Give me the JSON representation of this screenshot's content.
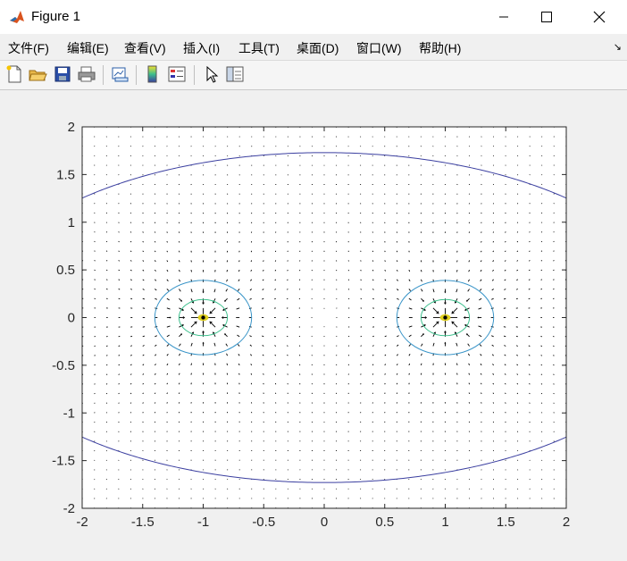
{
  "window": {
    "title": "Figure 1"
  },
  "menu": [
    {
      "label": "文件(F)"
    },
    {
      "label": "编辑(E)"
    },
    {
      "label": "查看(V)"
    },
    {
      "label": "插入(I)"
    },
    {
      "label": "工具(T)"
    },
    {
      "label": "桌面(D)"
    },
    {
      "label": "窗口(W)"
    },
    {
      "label": "帮助(H)"
    }
  ],
  "toolbar": {
    "icons": [
      "new-figure-icon",
      "open-file-icon",
      "save-icon",
      "print-icon",
      "link-plot-icon",
      "colorbar-icon",
      "legend-icon",
      "edit-plot-arrow-icon",
      "property-inspector-icon"
    ]
  },
  "colors": {
    "axes_bg": "#ffffff",
    "figure_bg": "#f0f0f0",
    "quiver": "#000000",
    "contour_outer": "#3b3fa0",
    "contour_mid": "#3a95c8",
    "contour_inner": "#3cbf8c",
    "contour_center": "#e0d020"
  },
  "chart_data": {
    "type": "contour+quiver",
    "title": "",
    "xlabel": "",
    "ylabel": "",
    "xlim": [
      -2,
      2
    ],
    "ylim": [
      -2,
      2
    ],
    "xticks": [
      "-2",
      "-1.5",
      "-1",
      "-0.5",
      "0",
      "0.5",
      "1",
      "1.5",
      "2"
    ],
    "yticks": [
      "2",
      "1.5",
      "1",
      "0.5",
      "0",
      "-0.5",
      "-1",
      "-1.5",
      "-2"
    ],
    "charges": [
      {
        "x": -1,
        "y": 0
      },
      {
        "x": 1,
        "y": 0
      }
    ],
    "contours": [
      {
        "level": "outer",
        "color": "#3b3fa0",
        "shape": "single closed curve around both charges",
        "y_at_x0": 1.73,
        "y_at_x2": 1.06
      },
      {
        "level": "mid",
        "color": "#3a95c8",
        "rx": 0.4,
        "ry": 0.39
      },
      {
        "level": "inner",
        "color": "#3cbf8c",
        "rx": 0.2,
        "ry": 0.19
      },
      {
        "level": "center",
        "color": "#e0d020",
        "rx": 0.04,
        "ry": 0.03
      }
    ],
    "quiver": {
      "grid_step": 0.1,
      "direction": "toward charges",
      "color": "#000000"
    },
    "grid": false,
    "legend": "none"
  }
}
